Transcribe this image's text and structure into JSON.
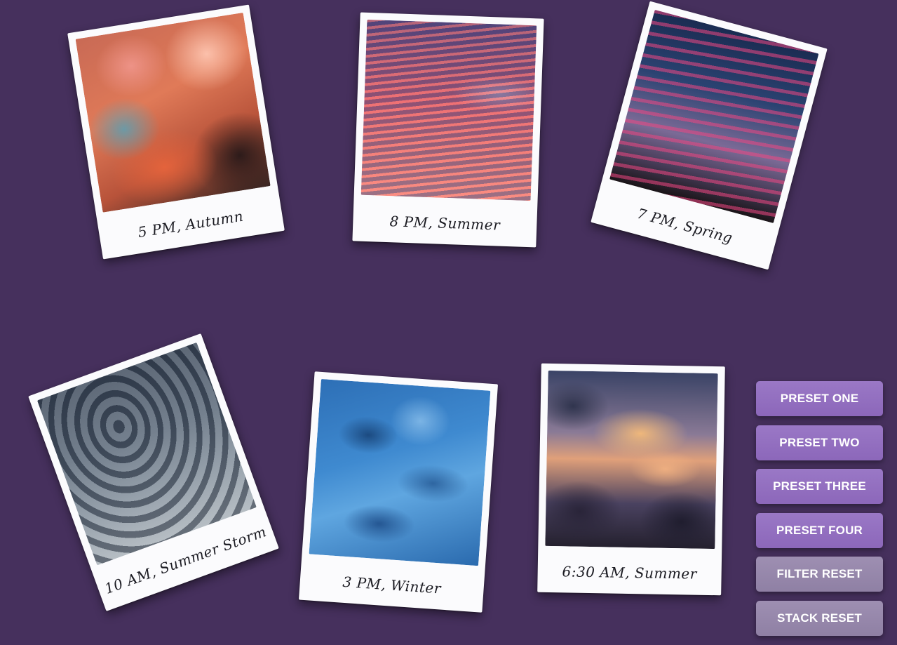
{
  "background_color": "#46305d",
  "photos": [
    {
      "caption": "5 PM, Autumn"
    },
    {
      "caption": "8 PM, Summer"
    },
    {
      "caption": "7 PM, Spring"
    },
    {
      "caption": "10 AM, Summer Storm"
    },
    {
      "caption": "3 PM, Winter"
    },
    {
      "caption": "6:30 AM, Summer"
    }
  ],
  "controls": {
    "preset_one": "PRESET ONE",
    "preset_two": "PRESET TWO",
    "preset_three": "PRESET THREE",
    "preset_four": "PRESET FOUR",
    "filter_reset": "FILTER RESET",
    "stack_reset": "STACK RESET"
  },
  "colors": {
    "preset_button": "#9372c2",
    "reset_button": "#9888ac",
    "polaroid_frame": "#fbfbfd"
  }
}
